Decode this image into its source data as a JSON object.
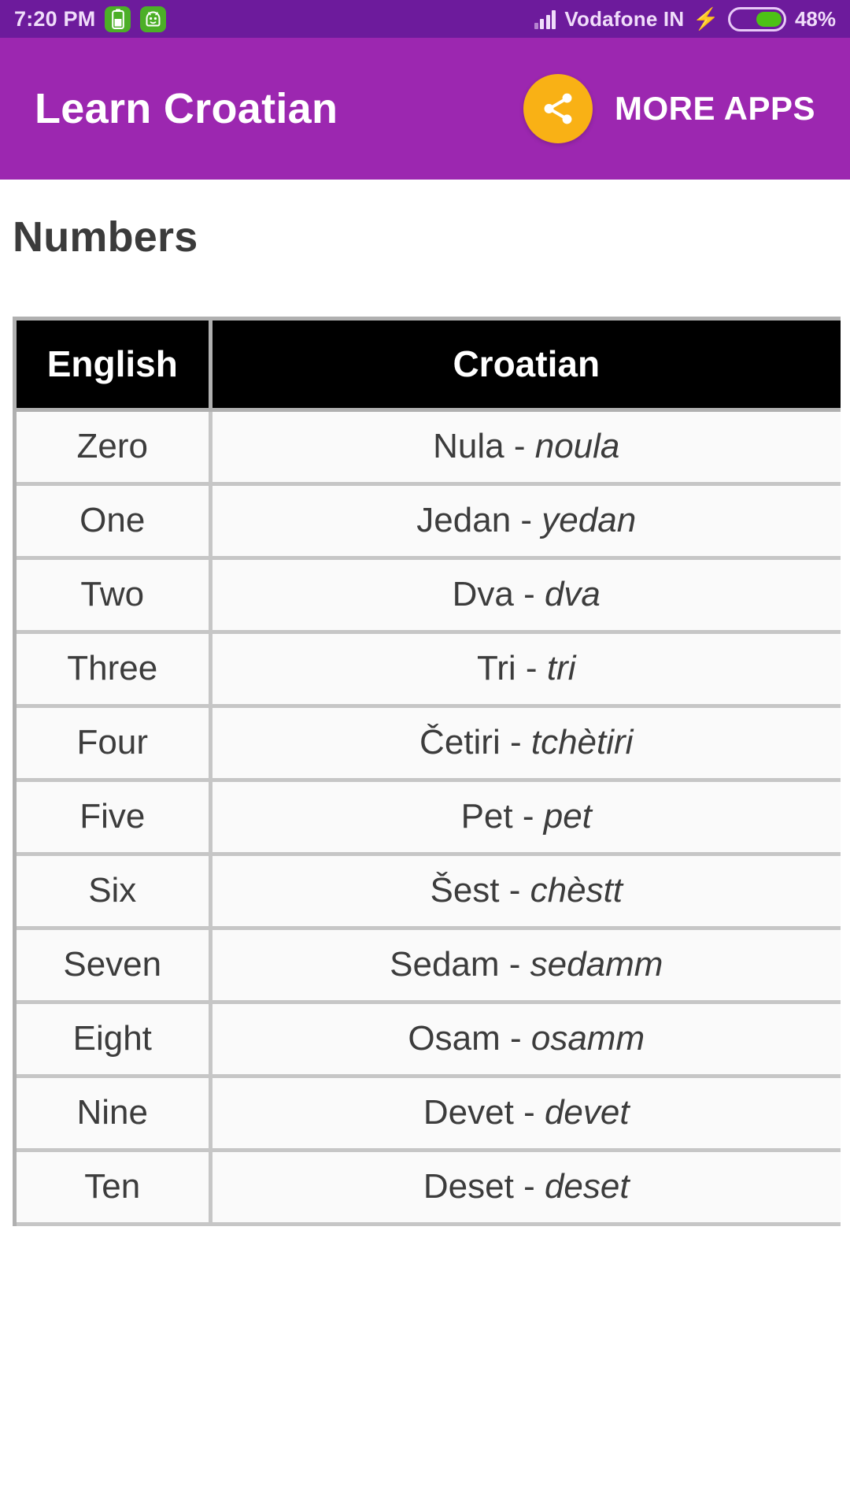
{
  "statusbar": {
    "time": "7:20 PM",
    "carrier": "Vodafone IN",
    "battery_percent": "48%",
    "charging_icon": "bolt-icon",
    "signal_icon": "signal-bars-icon",
    "notifications": [
      {
        "icon": "battery-notification-icon"
      },
      {
        "icon": "android-robot-notification-icon"
      }
    ],
    "colors": {
      "background": "#6d1b9c",
      "text": "#f0ddfa",
      "battery_fill": "#4dc216",
      "notif_chip": "#4caf27"
    }
  },
  "appbar": {
    "title": "Learn Croatian",
    "share_icon": "share-icon",
    "more_apps_label": "MORE APPS",
    "colors": {
      "background": "#9c27b0",
      "share_button": "#f9b115",
      "text": "#ffffff"
    }
  },
  "page": {
    "title": "Numbers"
  },
  "table": {
    "columns": [
      "English",
      "Croatian"
    ],
    "rows": [
      {
        "english": "Zero",
        "croatian": "Nula",
        "dash": " - ",
        "pronunciation": "noula"
      },
      {
        "english": "One",
        "croatian": "Jedan",
        "dash": " - ",
        "pronunciation": "yedan"
      },
      {
        "english": "Two",
        "croatian": "Dva",
        "dash": " - ",
        "pronunciation": "dva"
      },
      {
        "english": "Three",
        "croatian": "Tri",
        "dash": " - ",
        "pronunciation": "tri"
      },
      {
        "english": "Four",
        "croatian": "Četiri",
        "dash": " - ",
        "pronunciation": "tchètiri"
      },
      {
        "english": "Five",
        "croatian": "Pet",
        "dash": " - ",
        "pronunciation": "pet"
      },
      {
        "english": "Six",
        "croatian": "Šest",
        "dash": " - ",
        "pronunciation": "chèstt"
      },
      {
        "english": "Seven",
        "croatian": "Sedam",
        "dash": " - ",
        "pronunciation": "sedamm"
      },
      {
        "english": "Eight",
        "croatian": "Osam",
        "dash": " - ",
        "pronunciation": "osamm"
      },
      {
        "english": "Nine",
        "croatian": "Devet",
        "dash": " - ",
        "pronunciation": "devet"
      },
      {
        "english": "Ten",
        "croatian": "Deset",
        "dash": " - ",
        "pronunciation": "deset"
      }
    ]
  }
}
